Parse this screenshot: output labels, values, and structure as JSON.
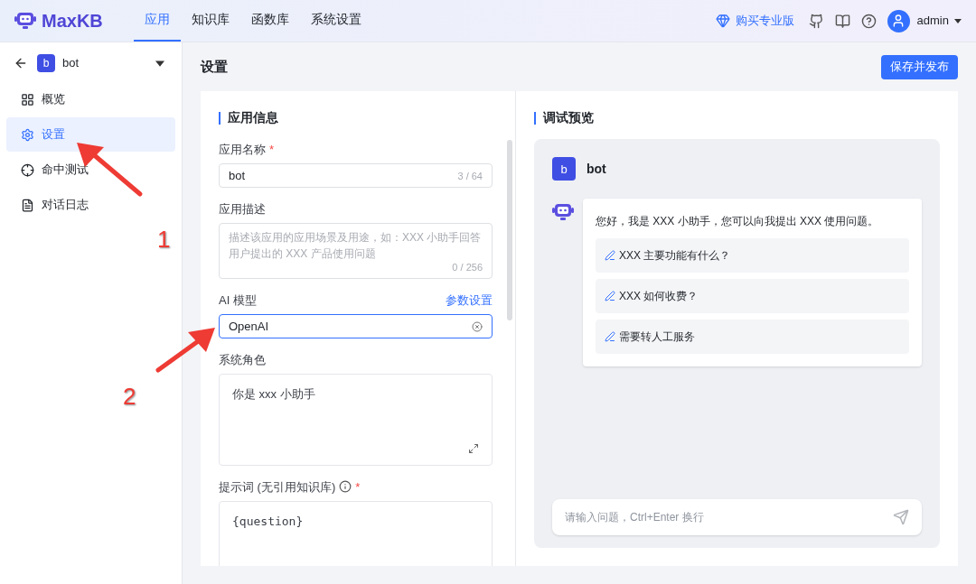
{
  "header": {
    "logo": "MaxKB",
    "nav": [
      {
        "label": "应用",
        "selected": true
      },
      {
        "label": "知识库",
        "selected": false
      },
      {
        "label": "函数库",
        "selected": false
      },
      {
        "label": "系统设置",
        "selected": false
      }
    ],
    "upgrade": "购买专业版",
    "user": "admin"
  },
  "sidebar": {
    "app_avatar": "b",
    "app_name": "bot",
    "items": [
      {
        "label": "概览",
        "selected": false
      },
      {
        "label": "设置",
        "selected": true
      },
      {
        "label": "命中测试",
        "selected": false
      },
      {
        "label": "对话日志",
        "selected": false
      }
    ]
  },
  "page": {
    "title": "设置",
    "save_button": "保存并发布"
  },
  "form": {
    "section_title": "应用信息",
    "fields": [
      {
        "kind": "input",
        "label": "应用名称",
        "required_mark": "*",
        "value": "bot",
        "count": "3 / 64"
      },
      {
        "kind": "textarea",
        "label": "应用描述",
        "placeholder": "描述该应用的应用场景及用途，如：XXX 小助手回答用户提出的 XXX 产品使用问题",
        "count": "0 / 256"
      },
      {
        "kind": "select",
        "label": "AI 模型",
        "link": "参数设置",
        "value": "OpenAI"
      },
      {
        "kind": "editor",
        "label": "系统角色",
        "value": "你是 xxx 小助手"
      },
      {
        "kind": "prompt",
        "label": "提示词 (无引用知识库)",
        "required_mark": "*",
        "value": "{question}"
      }
    ]
  },
  "preview": {
    "title": "调试预览",
    "bot_avatar": "b",
    "bot_name": "bot",
    "greeting": "您好，我是 XXX 小助手，您可以向我提出 XXX 使用问题。",
    "questions": [
      "XXX 主要功能有什么？",
      "XXX 如何收费？",
      "需要转人工服务"
    ],
    "input_placeholder": "请输入问题，Ctrl+Enter 换行"
  },
  "annotations": [
    {
      "label": "1"
    },
    {
      "label": "2"
    }
  ]
}
